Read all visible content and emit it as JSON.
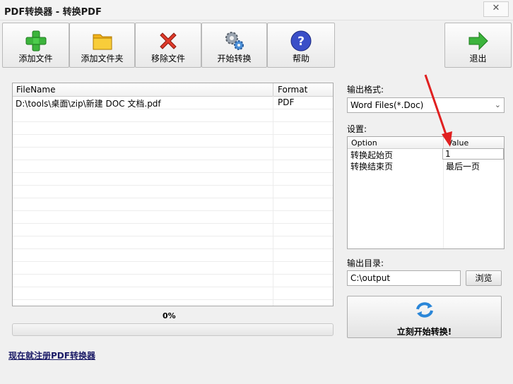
{
  "window": {
    "title": "PDF转换器 - 转换PDF",
    "close_symbol": "✕"
  },
  "toolbar": {
    "add_file": "添加文件",
    "add_folder": "添加文件夹",
    "remove_file": "移除文件",
    "start_convert": "开始转换",
    "help": "帮助",
    "exit": "退出"
  },
  "file_list": {
    "columns": [
      "FileName",
      "Format"
    ],
    "rows": [
      {
        "filename": "D:\\tools\\桌面\\zip\\新建 DOC 文档.pdf",
        "format": "PDF"
      }
    ]
  },
  "progress": {
    "text": "0%",
    "value": 0
  },
  "register_link": "现在就注册PDF转换器",
  "output_format": {
    "label": "输出格式:",
    "value": "Word Files(*.Doc)"
  },
  "settings": {
    "label": "设置:",
    "columns": [
      "Option",
      "Value"
    ],
    "rows": [
      {
        "option": "转换起始页",
        "value": "1"
      },
      {
        "option": "转换结束页",
        "value": "最后一页"
      }
    ]
  },
  "output_dir": {
    "label": "输出目录:",
    "value": "C:\\output",
    "browse": "浏览"
  },
  "convert_now": "立刻开始转换!",
  "colors": {
    "accent_arrow": "#e02020",
    "progress_fill": "#3fae3f"
  }
}
